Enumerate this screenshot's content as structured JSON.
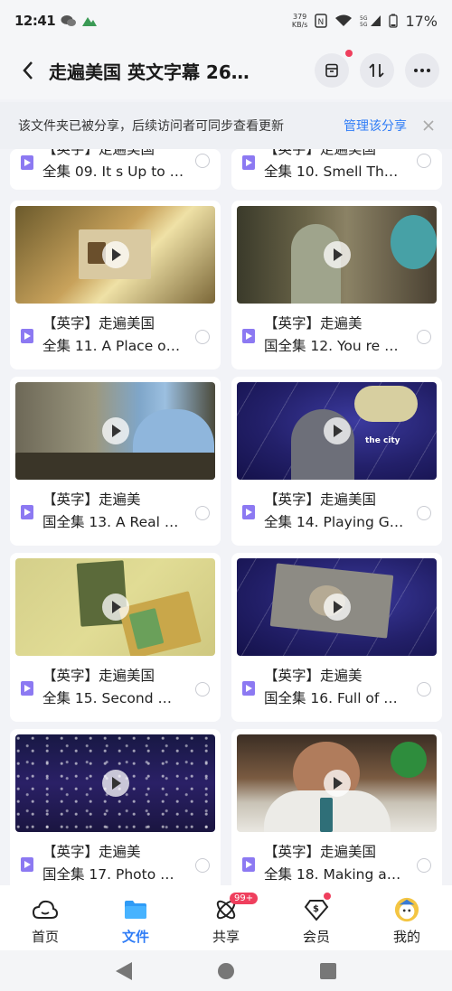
{
  "status": {
    "time": "12:41",
    "network_speed": "379",
    "network_unit": "KB/s",
    "battery": "17%"
  },
  "header": {
    "title": "走遍美国 英文字幕 26…"
  },
  "notice": {
    "text": "该文件夹已被分享，后续访问者可同步查看更新",
    "action": "管理该分享"
  },
  "files": [
    {
      "line1": "【英字】走遍美国",
      "line2": "全集 09. It s Up to …",
      "thumb": "partial"
    },
    {
      "line1": "【英字】走遍美国",
      "line2": "全集 10. Smell Th…",
      "thumb": "partial"
    },
    {
      "line1": "【英字】走遍美国",
      "line2": "全集 11. A Place o…",
      "thumb": "sepia"
    },
    {
      "line1": "【英字】走遍美",
      "line2": "国全集 12. You re …",
      "thumb": "room"
    },
    {
      "line1": "【英字】走遍美",
      "line2": "国全集 13. A Real …",
      "thumb": "office"
    },
    {
      "line1": "【英字】走遍美国",
      "line2": "全集 14. Playing G…",
      "thumb": "space",
      "overlay": "the city"
    },
    {
      "line1": "【英字】走遍美国",
      "line2": "全集 15. Second …",
      "thumb": "yellow"
    },
    {
      "line1": "【英字】走遍美",
      "line2": "国全集 16. Full of …",
      "thumb": "space"
    },
    {
      "line1": "【英字】走遍美",
      "line2": "国全集 17. Photo …",
      "thumb": "nightcity"
    },
    {
      "line1": "【英字】走遍美国",
      "line2": "全集 18. Making a…",
      "thumb": "portrait"
    }
  ],
  "nav": [
    {
      "label": "首页"
    },
    {
      "label": "文件"
    },
    {
      "label": "共享",
      "badge": "99+"
    },
    {
      "label": "会员"
    },
    {
      "label": "我的"
    }
  ],
  "colors": {
    "accent": "#2f7cf6",
    "badge": "#ef3f5d",
    "file_icon": "#8c79f2"
  }
}
